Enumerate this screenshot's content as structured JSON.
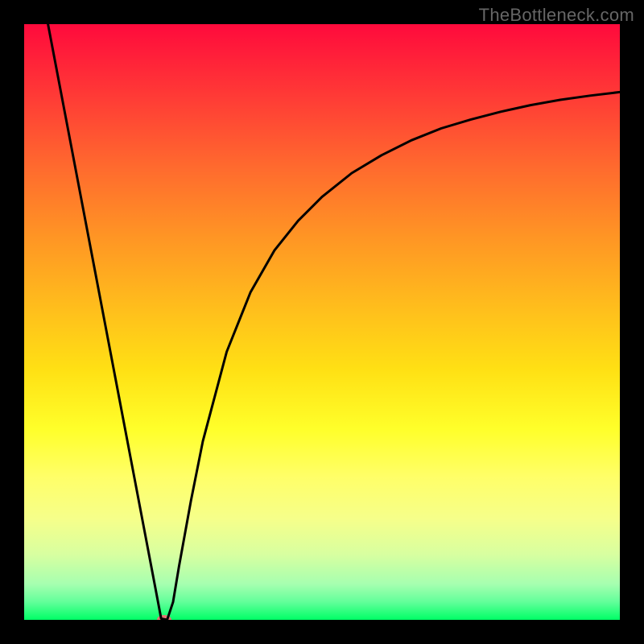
{
  "watermark": "TheBottleneck.com",
  "chart_data": {
    "type": "line",
    "title": "",
    "xlabel": "",
    "ylabel": "",
    "xlim": [
      0,
      100
    ],
    "ylim": [
      0,
      100
    ],
    "grid": false,
    "background_gradient": {
      "top": "#ff0a3c",
      "bottom": "#00ff66",
      "meaning": "red=high bottleneck, green=no bottleneck"
    },
    "series": [
      {
        "name": "bottleneck-curve",
        "color": "#000000",
        "x": [
          4,
          6,
          8,
          10,
          12,
          14,
          16,
          18,
          20,
          22,
          23,
          24,
          25,
          26,
          28,
          30,
          34,
          38,
          42,
          46,
          50,
          55,
          60,
          65,
          70,
          75,
          80,
          85,
          90,
          95,
          100
        ],
        "y": [
          100,
          89.5,
          79,
          68.5,
          58,
          47.5,
          37,
          26.5,
          16,
          5.5,
          0.2,
          0.0,
          3,
          9,
          20,
          30,
          45,
          55,
          62,
          67,
          71,
          75,
          78,
          80.5,
          82.5,
          84,
          85.3,
          86.4,
          87.3,
          88,
          88.6
        ]
      }
    ],
    "marker": {
      "name": "optimal-point",
      "x": 23.5,
      "y": 0,
      "color": "#e57373",
      "rx": 9,
      "ry": 6
    }
  }
}
